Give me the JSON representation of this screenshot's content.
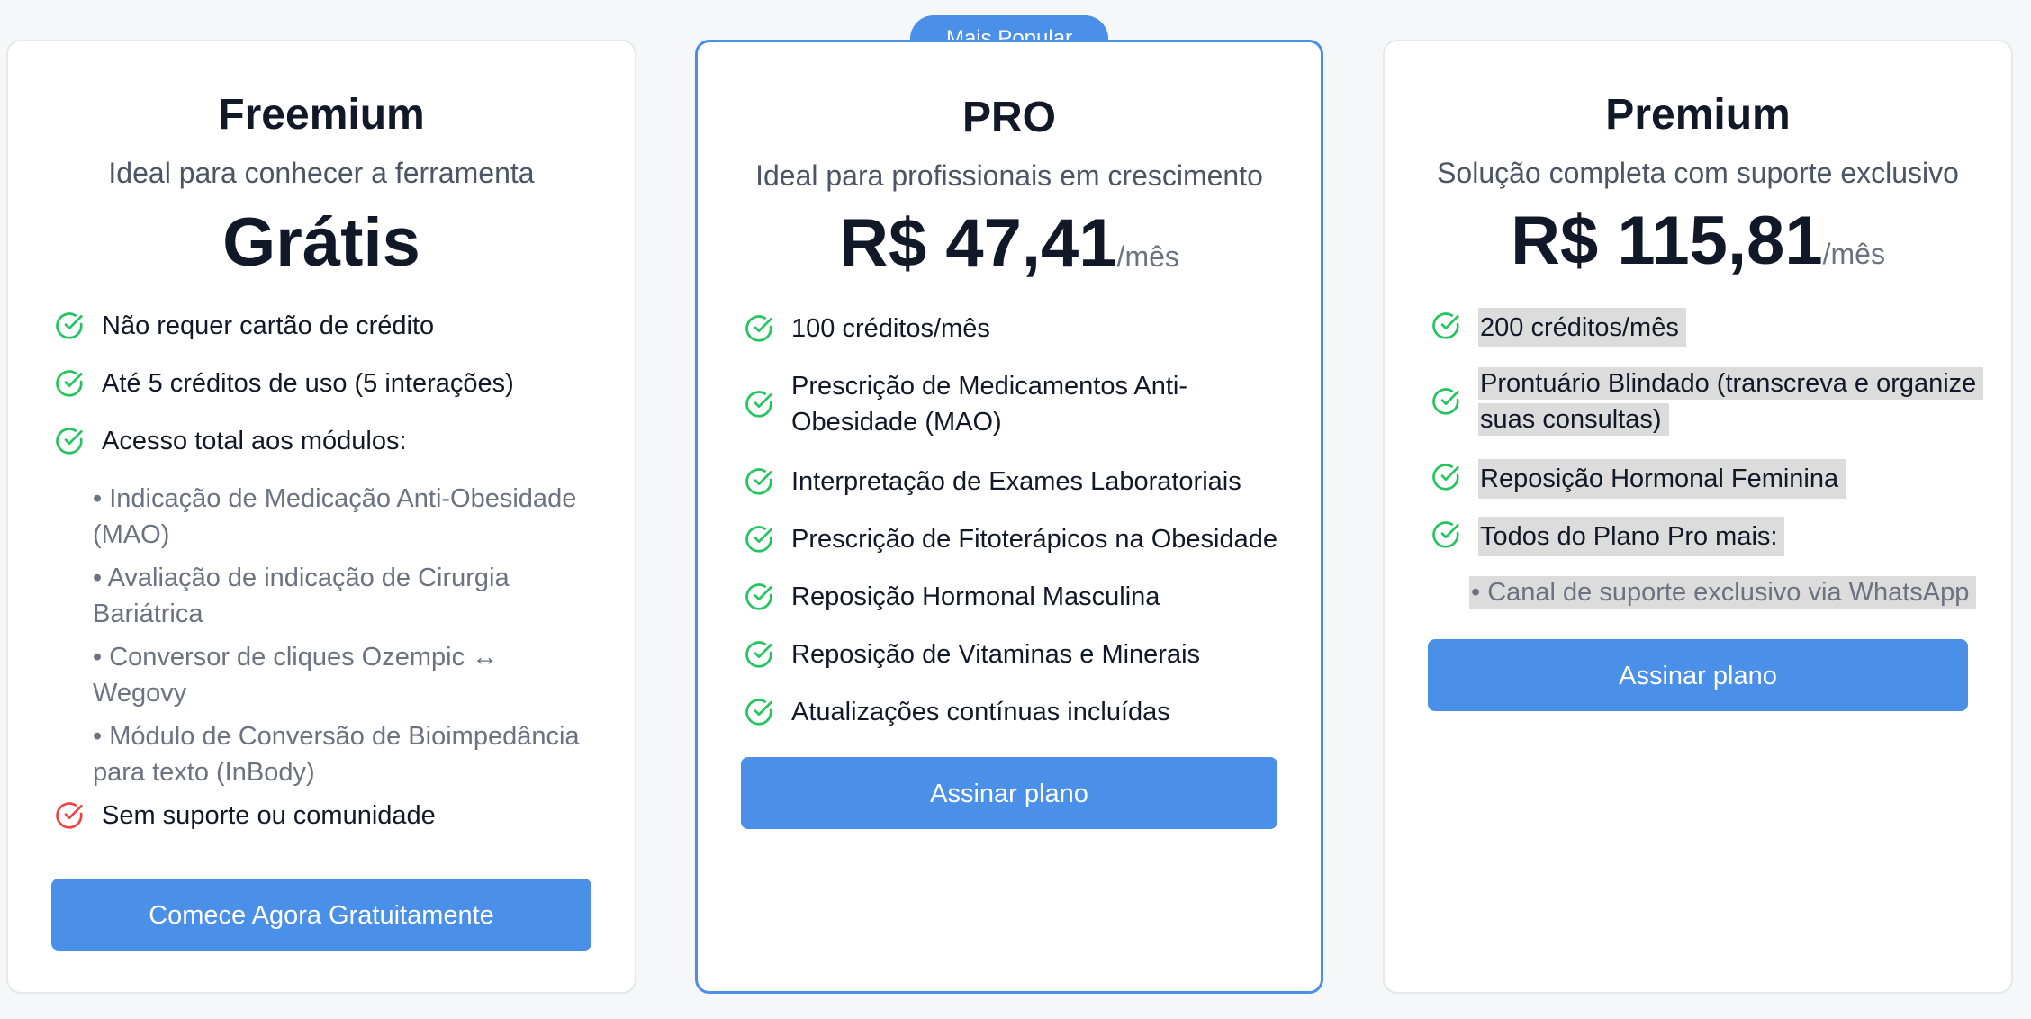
{
  "colors": {
    "accent": "#4a8fe8",
    "check_green": "#22c55e",
    "x_red": "#ef4444"
  },
  "badge": "Mais Popular",
  "plans": [
    {
      "name": "Freemium",
      "subtitle": "Ideal para conhecer a ferramenta",
      "price": "Grátis",
      "features": [
        {
          "icon": "check-circle-icon",
          "label": "Não requer cartão de crédito"
        },
        {
          "icon": "check-circle-icon",
          "label": "Até 5 créditos de uso (5 interações)"
        },
        {
          "icon": "check-circle-icon",
          "label": "Acesso total aos módulos:"
        }
      ],
      "sub_items": [
        "• Indicação de Medicação Anti-Obesidade (MAO)",
        "• Avaliação de indicação de Cirurgia Bariátrica",
        "• Conversor de cliques Ozempic ↔ Wegovy",
        "• Módulo de Conversão de Bioimpedância para texto (InBody)"
      ],
      "negative_feature": {
        "icon": "x-circle-icon",
        "label": "Sem suporte ou comunidade"
      },
      "button": "Comece Agora Gratuitamente"
    },
    {
      "name": "PRO",
      "subtitle": "Ideal para profissionais em crescimento",
      "price": "R$ 47,41",
      "period": "/mês",
      "features": [
        {
          "icon": "check-circle-icon",
          "label": "100 créditos/mês"
        },
        {
          "icon": "check-circle-icon",
          "label": "Prescrição de Medicamentos Anti-Obesidade (MAO)"
        },
        {
          "icon": "check-circle-icon",
          "label": "Interpretação de Exames Laboratoriais"
        },
        {
          "icon": "check-circle-icon",
          "label": "Prescrição de Fitoterápicos na Obesidade"
        },
        {
          "icon": "check-circle-icon",
          "label": "Reposição Hormonal Masculina"
        },
        {
          "icon": "check-circle-icon",
          "label": "Reposição de Vitaminas e Minerais"
        },
        {
          "icon": "check-circle-icon",
          "label": "Atualizações contínuas incluídas"
        }
      ],
      "button": "Assinar plano"
    },
    {
      "name": "Premium",
      "subtitle": "Solução completa com suporte exclusivo",
      "price": "R$ 115,81",
      "period": "/mês",
      "features": [
        {
          "icon": "check-circle-icon",
          "label": "200 créditos/mês"
        },
        {
          "icon": "check-circle-icon",
          "label": "Prontuário Blindado (transcreva e organize suas consultas)"
        },
        {
          "icon": "check-circle-icon",
          "label": "Reposição Hormonal Feminina"
        },
        {
          "icon": "check-circle-icon",
          "label": "Todos do Plano Pro mais:"
        }
      ],
      "sub_items": [
        "• Canal de suporte exclusivo via WhatsApp"
      ],
      "button": "Assinar plano"
    }
  ]
}
